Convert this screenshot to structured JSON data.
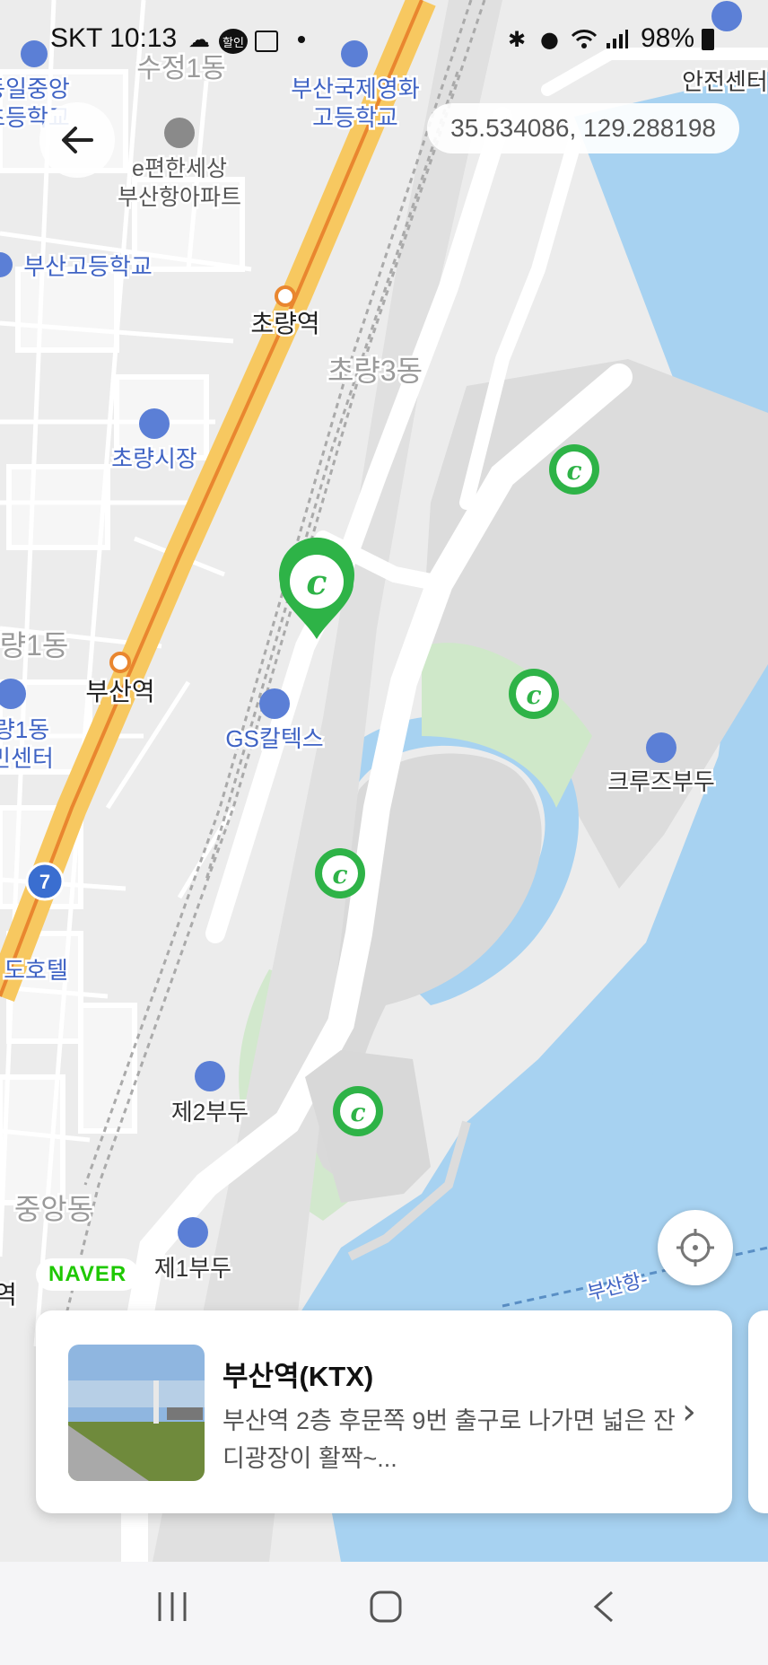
{
  "status": {
    "carrier_time": "SKT 10:13",
    "battery": "98%",
    "sale_badge": "할인"
  },
  "coordinates": "35.534086, 129.288198",
  "map_labels": {
    "sujeong1dong": "수정1동",
    "busan_intl_highschool": "부산국제영화\n고등학교",
    "dongil_school": "동일중앙\n초등학교",
    "anjeon": "안전센터",
    "e_apartment": "e편한세상\n부산항아파트",
    "busan_highschool": "부산고등학교",
    "choryang_station": "초량역",
    "choryang3dong": "초량3동",
    "choryang_market": "초량시장",
    "ryang1dong": "량1동",
    "busan_station": "부산역",
    "ryang1dong_center": "량1동\n민센터",
    "gs_caltex": "GS칼텍스",
    "cruise_terminal": "크루즈부두",
    "road_7": "7",
    "hotel": "도호텔",
    "pier2": "제2부두",
    "jungang_dong": "중앙동",
    "pier1": "제1부두",
    "yeok": "역",
    "busan_port_route": "부산항-"
  },
  "naver_logo": "NAVER",
  "card": {
    "title": "부산역(KTX)",
    "description": "부산역 2층 후문쪽 9번 출구로 나가면 넓은 잔디광장이 활짝~..."
  },
  "colors": {
    "sea": "#a7d2f1",
    "land": "#ececec",
    "road": "#ffffff",
    "highway": "#f7c860",
    "marker_green": "#2eb347",
    "label_blue": "#3f63c4"
  },
  "icons": {
    "back": "arrow-left-icon",
    "locate": "crosshair-icon",
    "marker": "c-marker-icon",
    "nav_recent": "recent-apps-icon",
    "nav_home": "home-icon",
    "nav_back": "back-chevron-icon"
  }
}
